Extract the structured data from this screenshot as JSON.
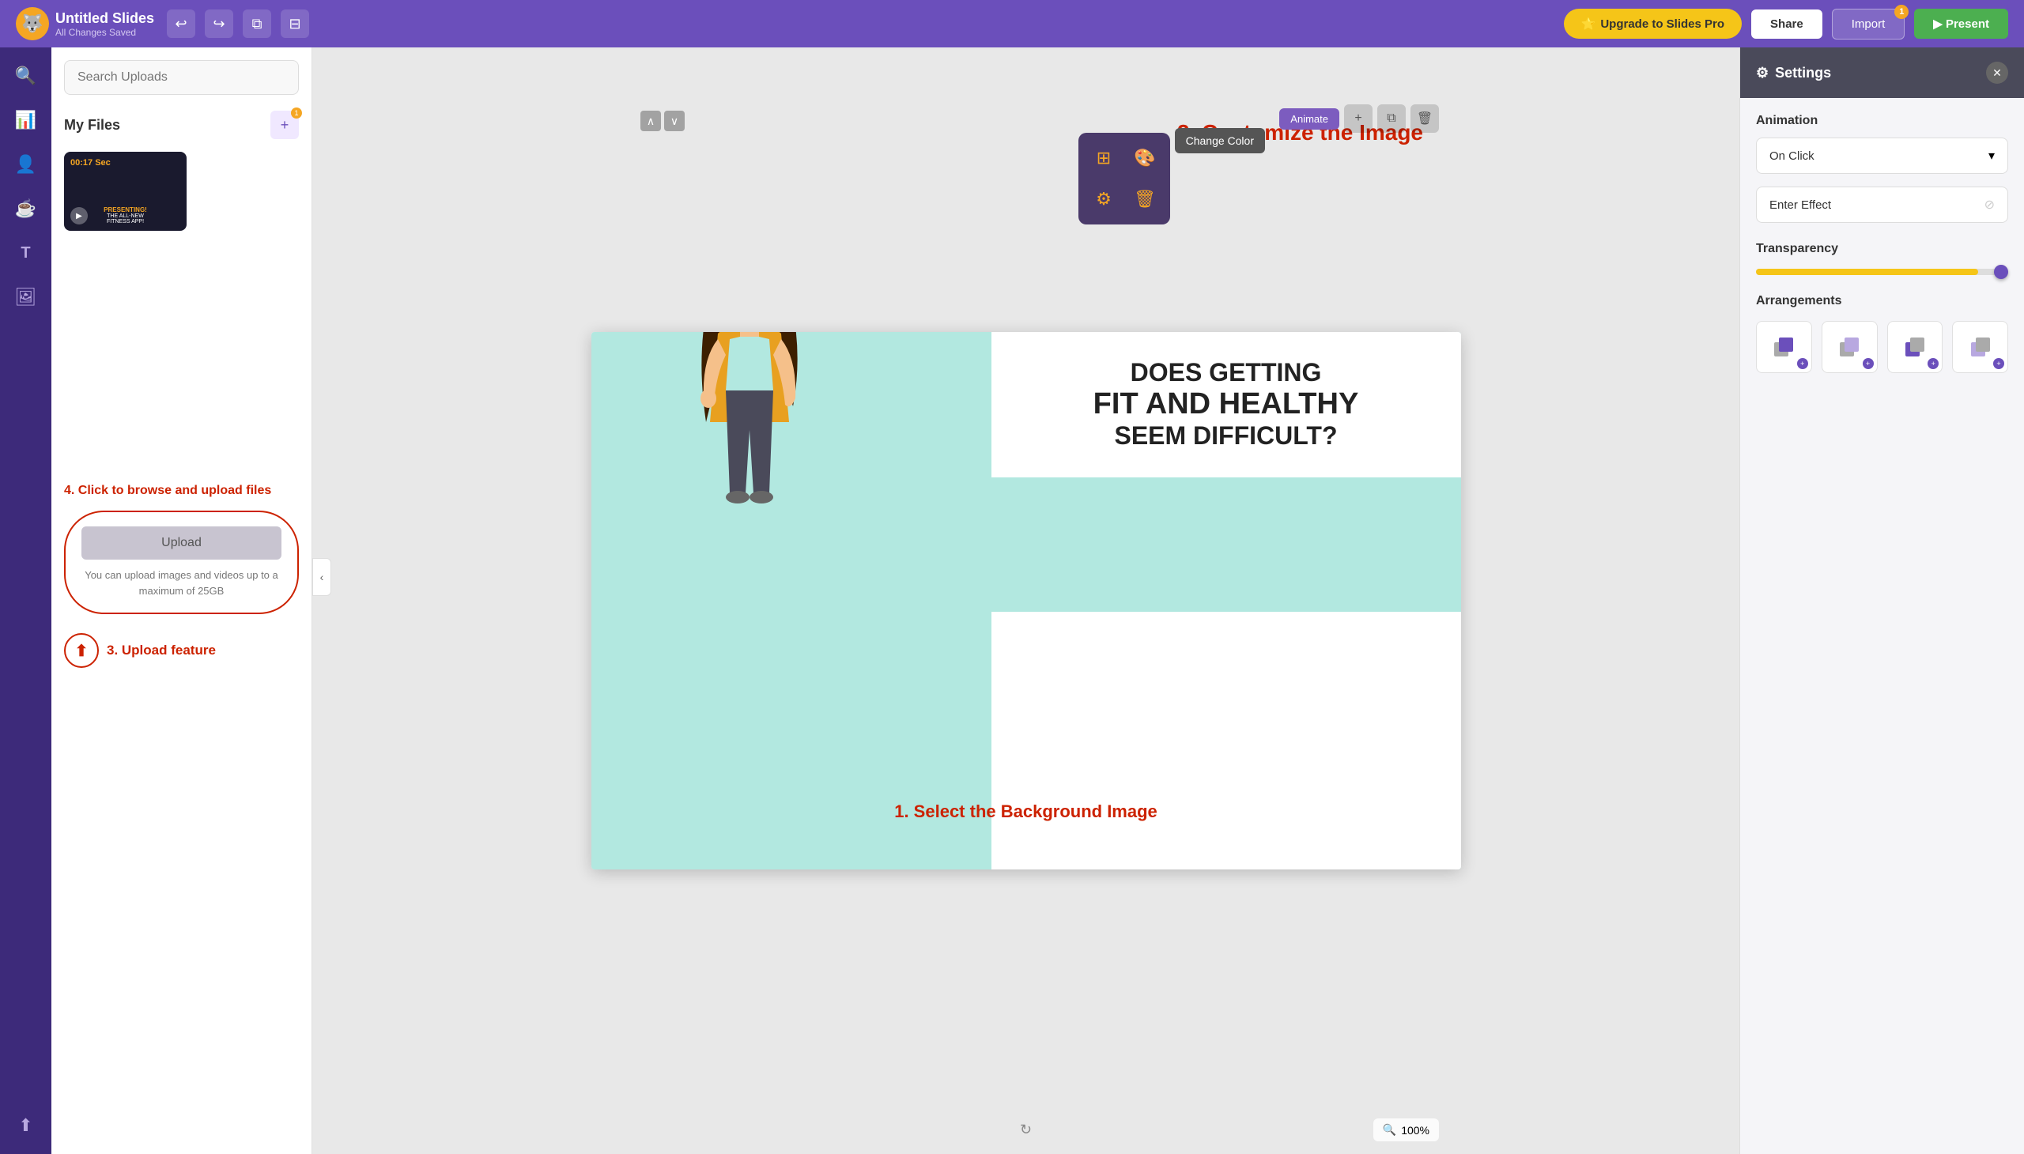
{
  "app": {
    "logo_emoji": "🐺",
    "title": "Untitled Slides",
    "subtitle": "All Changes Saved"
  },
  "topbar": {
    "undo_label": "↩",
    "redo_label": "↪",
    "duplicate_label": "⧉",
    "layout_label": "⊟",
    "upgrade_label": "Upgrade to Slides Pro",
    "share_label": "Share",
    "import_label": "Import",
    "import_badge": "1",
    "present_label": "▶ Present"
  },
  "left_sidebar": {
    "icons": [
      "🔍",
      "📊",
      "👤",
      "☕",
      "T",
      "🖼",
      "⬆"
    ]
  },
  "upload_panel": {
    "search_placeholder": "Search Uploads",
    "my_files_label": "My Files",
    "video_duration": "00:17 Sec",
    "video_label": "PRESENTING!\nTHE ALL-NEW\nFITNESS APP!",
    "click_to_browse": "4. Click to browse and upload files",
    "upload_button_label": "Upload",
    "upload_caption": "You can upload images and videos up to a maximum of 25GB",
    "upload_feature_label": "3. Upload feature"
  },
  "slide": {
    "title_text1": "DOES GETTING",
    "title_text2": "FIT AND HEALTHY",
    "title_text3": "SEEM DIFFICULT?",
    "select_bg_text": "1. Select the Background Image",
    "zoom_percent": "100%",
    "customize_label": "2. Customize the Image"
  },
  "toolbar": {
    "animate_label": "Animate",
    "add_label": "+",
    "duplicate_label": "⧉",
    "delete_label": "🗑"
  },
  "context_menu": {
    "resize_icon": "⊞",
    "color_icon": "🎨",
    "settings_icon": "⚙",
    "delete_icon": "🗑",
    "change_color_tooltip": "Change Color"
  },
  "settings": {
    "title": "Settings",
    "animation_label": "Animation",
    "animation_value": "On Click",
    "enter_effect_label": "Enter Effect",
    "transparency_label": "Transparency",
    "transparency_value": 88,
    "arrangements_label": "Arrangements",
    "arrangements": [
      {
        "label": "front"
      },
      {
        "label": "forward"
      },
      {
        "label": "backward"
      },
      {
        "label": "back"
      }
    ]
  }
}
